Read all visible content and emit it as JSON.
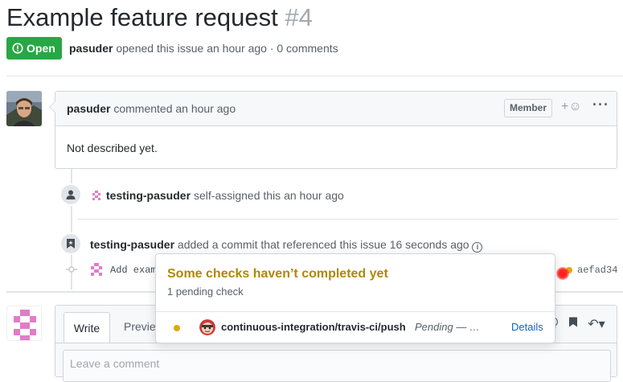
{
  "issue": {
    "title": "Example feature request",
    "number": "#4",
    "state": "Open",
    "author": "pasuder",
    "opened_text": "opened this issue an hour ago · 0 comments"
  },
  "comment": {
    "author": "pasuder",
    "time_text": "commented an hour ago",
    "role_badge": "Member",
    "body": "Not described yet."
  },
  "events": [
    {
      "actor": "testing-pasuder",
      "text": "self-assigned this an hour ago"
    },
    {
      "actor": "testing-pasuder",
      "text": "added a commit that referenced this issue 16 seconds ago"
    }
  ],
  "commit": {
    "message": "Add exam",
    "sha": "aefad34"
  },
  "popover": {
    "title": "Some checks haven’t completed yet",
    "subtitle": "1 pending check",
    "check_name": "continuous-integration/travis-ci/push",
    "check_status": "Pending — …",
    "details_link": "Details"
  },
  "new_comment": {
    "tab_write": "Write",
    "tab_preview": "Previe",
    "placeholder": "Leave a comment"
  },
  "colors": {
    "open_green": "#28a745",
    "pending_yellow": "#dbab09",
    "pending_title": "#b08800",
    "link_blue": "#0366d6"
  }
}
